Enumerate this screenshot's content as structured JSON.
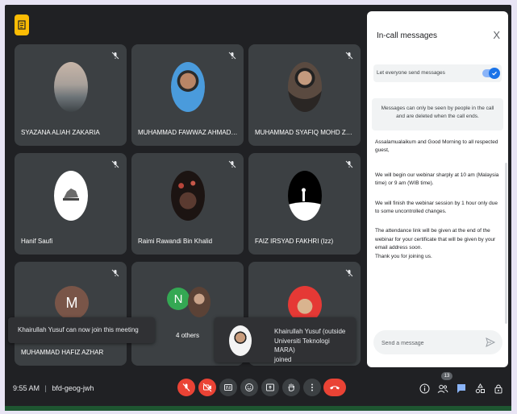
{
  "meeting": {
    "time": "9:55 AM",
    "separator": "|",
    "code": "bfd-geog-jwh"
  },
  "participants": [
    {
      "name": "SYAZANA ALIAH ZAKARIA"
    },
    {
      "name": "MUHAMMAD FAWWAZ AHMAD SAL..."
    },
    {
      "name": "MUHAMMAD SYAFIQ MOHD ZAHID"
    },
    {
      "name": "Hanif Saufi"
    },
    {
      "name": "Raimi Rawandi Bin Khalid"
    },
    {
      "name": "FAIZ IRSYAD FAKHRI (Izz)"
    },
    {
      "name": "MUHAMMAD HAFIZ AZHAR",
      "initial": "M"
    },
    {
      "name": "4 others",
      "initial": "N"
    },
    {
      "name": ""
    }
  ],
  "toasts": {
    "join_notice": "Khairullah Yusuf can now join this meeting",
    "joined_name": "Khairullah Yusuf (outside Universiti Teknologi MARA)",
    "joined_suffix": "joined"
  },
  "people_count": "13",
  "panel": {
    "title": "In-call messages",
    "close": "X",
    "toggle_label": "Let everyone send messages",
    "toggle_on": true,
    "notice": "Messages can only be seen by people in the call and are deleted when the call ends.",
    "messages": [
      "Assalamualaikum and Good Morning to all respected guest,",
      "We will begin our webinar sharply at 10 am (Malaysia time) or 9 am (WIB time).",
      "We will finish the webinar session by 1 hour only due to some uncontrolled changes.",
      "The attendance link will be given at the end of the webinar for your certificate that will be given by your email address soon.",
      "Thank you for joining us."
    ],
    "input_placeholder": "Send a message"
  },
  "colors": {
    "background": "#202124",
    "tile": "#3c4043",
    "danger": "#ea4335",
    "accent": "#1a73e8"
  }
}
